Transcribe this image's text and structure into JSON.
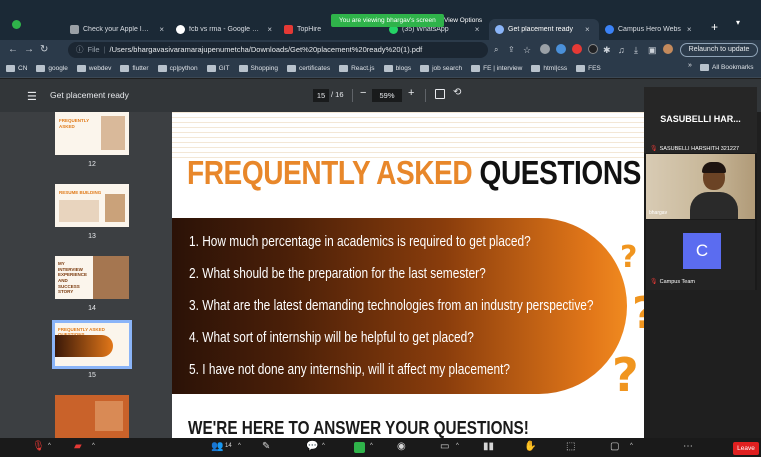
{
  "screen_share": {
    "banner": "You are viewing bhargav's screen",
    "view_options": "View Options"
  },
  "browser": {
    "tabs": [
      {
        "title": "Check your Apple ID de",
        "favicon_color": "#9aa0a6",
        "active": false
      },
      {
        "title": "fcb vs rma - Google Sea",
        "favicon_color": "#ffffff",
        "active": false
      },
      {
        "title": "TopHire",
        "favicon_color": "#e53935",
        "active": false
      },
      {
        "title": "(35) WhatsApp",
        "favicon_color": "#25d366",
        "active": false
      },
      {
        "title": "Get placement ready",
        "favicon_color": "#8ab4f8",
        "active": true
      },
      {
        "title": "Campus Hero Webs",
        "favicon_color": "#3b82f6",
        "active": false
      }
    ],
    "close_glyph": "×",
    "new_tab_glyph": "+",
    "tab_menu_glyph": "▾",
    "url_label": "File",
    "url": "/Users/bhargavasivaramarajupenumetcha/Downloads/Get%20placement%20ready%20(1).pdf",
    "relaunch_label": "Relaunch to update",
    "bookmarks": [
      "CN",
      "google",
      "webdev",
      "flutter",
      "cp|python",
      "GIT",
      "Shopping",
      "certificates",
      "React.js",
      "blogs",
      "job search",
      "FE | interview",
      "html|css",
      "FES"
    ],
    "bookmarks_more": "»",
    "all_bookmarks": "All Bookmarks"
  },
  "pdf": {
    "title": "Get placement ready",
    "current_page": "15",
    "total_pages": "/ 16",
    "zoom": "59%",
    "thumbnails": [
      {
        "number": "12",
        "text": "FREQUENTLY ASKED"
      },
      {
        "number": "13",
        "text": "RESUME BUILDING"
      },
      {
        "number": "14",
        "text": "MY INTERVIEW EXPERIENCE AND SUCCESS STORY"
      },
      {
        "number": "15",
        "text": "FREQUENTLY ASKED QUESTIONS",
        "selected": true
      },
      {
        "number": "",
        "text": ""
      }
    ]
  },
  "slide": {
    "title_orange": "FREQUENTLY ASKED",
    "title_black": "QUESTIONS",
    "questions": [
      "1. How much percentage in academics is required to get placed?",
      "2. What should be the preparation for the last semester?",
      "3. What are the latest demanding technologies from an industry perspective?",
      "4. What sort of internship will be helpful to get placed?",
      "5. I have not done any internship, will it affect my placement?"
    ],
    "bottom_heading": "WE'RE HERE TO ANSWER YOUR QUESTIONS!",
    "accent_color": "#e8872a"
  },
  "participants": {
    "header_name": "SASUBELLI HAR...",
    "header_sub": "SASUBELLI HARSHITH 321227",
    "video_label": "bhargav",
    "avatar_letter": "C",
    "avatar_label": "Campus Team"
  },
  "meeting_controls": {
    "participant_count": "14",
    "leave_label": "Leave"
  }
}
